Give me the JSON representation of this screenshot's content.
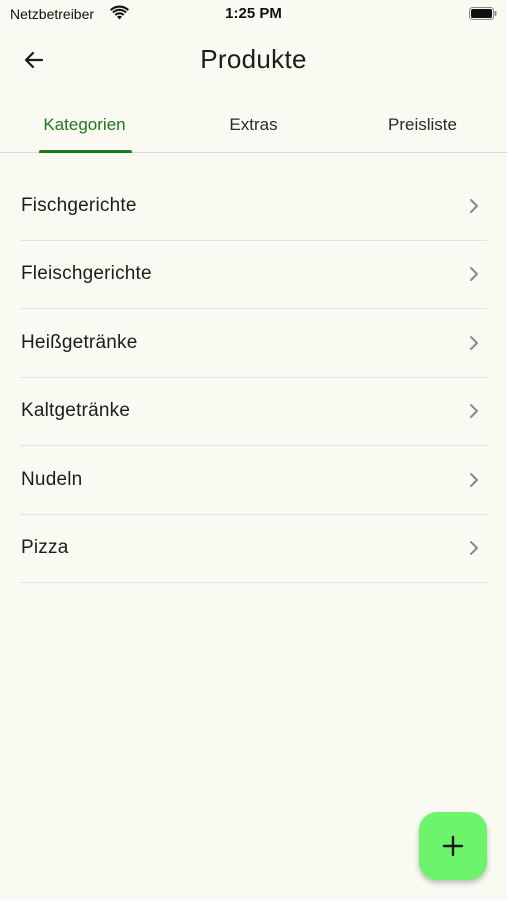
{
  "status_bar": {
    "carrier": "Netzbetreiber",
    "time": "1:25 PM",
    "icons": [
      "wifi-icon",
      "battery-icon"
    ]
  },
  "header": {
    "title": "Produkte",
    "back_icon": "arrow-left-icon"
  },
  "tabs": [
    {
      "label": "Kategorien",
      "active": true
    },
    {
      "label": "Extras",
      "active": false
    },
    {
      "label": "Preisliste",
      "active": false
    }
  ],
  "categories": [
    {
      "label": "Fischgerichte"
    },
    {
      "label": "Fleischgerichte"
    },
    {
      "label": "Heißgetränke"
    },
    {
      "label": "Kaltgetränke"
    },
    {
      "label": "Nudeln"
    },
    {
      "label": "Pizza"
    }
  ],
  "fab": {
    "icon": "plus-icon"
  },
  "colors": {
    "background": "#fafaf2",
    "accent": "#1b7a1b",
    "fab": "#6cf56c"
  }
}
